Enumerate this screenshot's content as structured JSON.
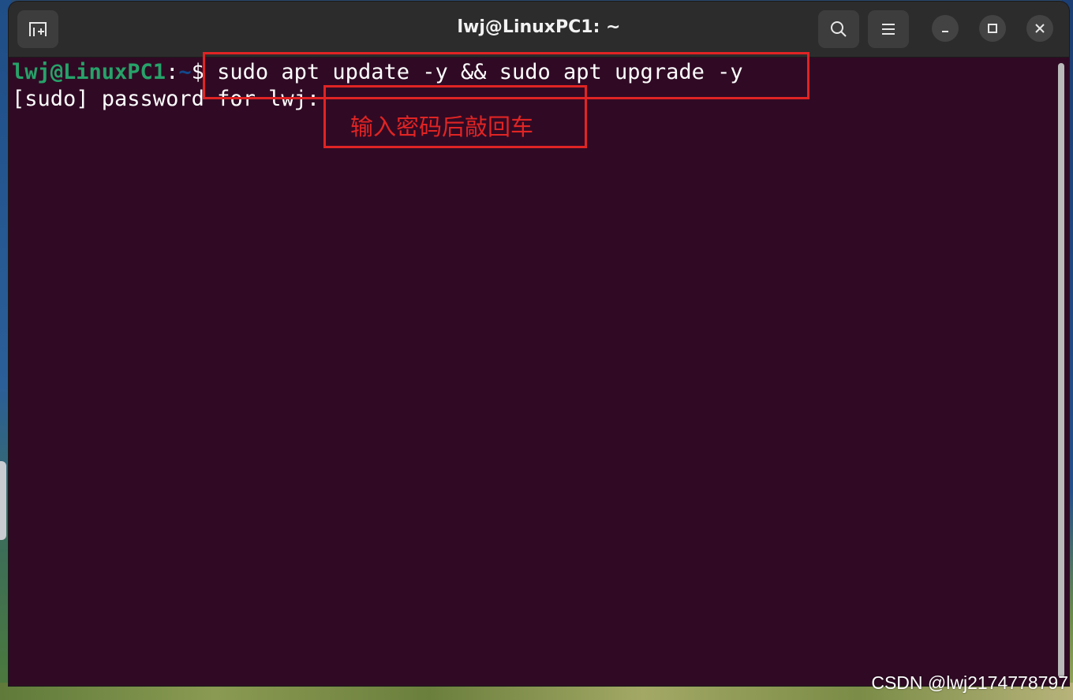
{
  "window": {
    "title": "lwj@LinuxPC1: ~"
  },
  "titlebar": {
    "new_tab_icon": "new-tab-icon",
    "search_icon": "search-icon",
    "menu_icon": "hamburger-menu-icon",
    "minimize_icon": "minimize-icon",
    "maximize_icon": "maximize-icon",
    "close_icon": "close-icon"
  },
  "terminal": {
    "prompt_user": "lwj@LinuxPC1",
    "prompt_colon": ":",
    "prompt_path": "~",
    "prompt_dollar": "$",
    "command": " sudo apt update -y && sudo apt upgrade -y",
    "password_prompt": "[sudo] password for lwj:"
  },
  "annotation": {
    "note": "输入密码后敲回车"
  },
  "watermark": "CSDN @lwj2174778797",
  "colors": {
    "terminal_bg": "#300a24",
    "titlebar_bg": "#2c2c2c",
    "prompt_user": "#26a269",
    "prompt_path": "#12488b",
    "annotation": "#e02424"
  }
}
